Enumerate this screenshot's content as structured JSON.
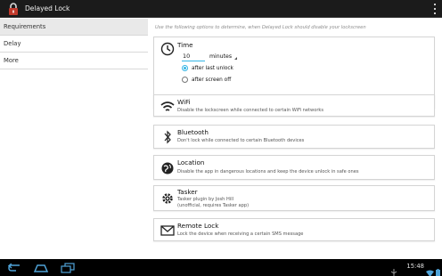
{
  "app": {
    "title": "Delayed Lock",
    "accent": "#33b5e5",
    "icon": "lock-icon"
  },
  "sidebar": {
    "items": [
      {
        "label": "Requirements",
        "selected": true
      },
      {
        "label": "Delay",
        "selected": false
      },
      {
        "label": "More",
        "selected": false
      }
    ]
  },
  "content": {
    "hint": "Use the following options to determine, when Delayed Lock should disable your lockscreen",
    "time": {
      "title": "Time",
      "value": "10",
      "unit": "minutes",
      "options": [
        {
          "label": "after last unlock",
          "selected": true
        },
        {
          "label": "after screen off",
          "selected": false
        }
      ]
    },
    "wifi": {
      "title": "WiFi",
      "desc": "Disable the lockscreen while connected to certain WiFi networks"
    },
    "bluetooth": {
      "title": "Bluetooth",
      "desc": "Don't lock while connected to certain Bluetooth devices"
    },
    "location": {
      "title": "Location",
      "desc": "Disable the app in dangerous locations and keep the device unlock in safe ones"
    },
    "tasker": {
      "title": "Tasker",
      "desc1": "Tasker plugin by Josh Hill",
      "desc2": "(unofficial, requires Tasker app)"
    },
    "remote": {
      "title": "Remote Lock",
      "desc": "Lock the device when receiving a certain SMS message"
    }
  },
  "navbar": {
    "clock": "15:48",
    "icons": [
      "back-icon",
      "home-icon",
      "recents-icon",
      "usb-icon",
      "wifi-status-icon",
      "battery-icon"
    ]
  }
}
